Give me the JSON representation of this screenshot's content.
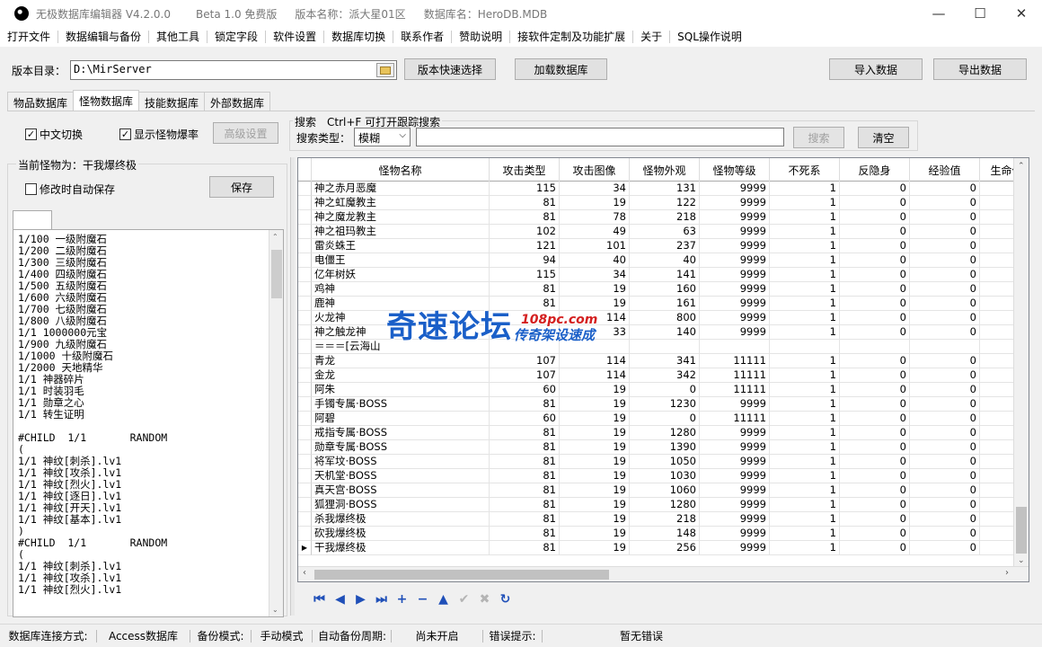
{
  "window": {
    "title_segments": [
      "无极数据库编辑器 V4.2.0.0",
      "Beta 1.0 免费版",
      "版本名称：派大星01区",
      "数据库名：HeroDB.MDB"
    ],
    "minimize": "—",
    "maximize": "☐",
    "close": "✕"
  },
  "menu": [
    "打开文件",
    "数据编辑与备份",
    "其他工具",
    "锁定字段",
    "软件设置",
    "数据库切换",
    "联系作者",
    "赞助说明",
    "接软件定制及功能扩展",
    "关于",
    "SQL操作说明"
  ],
  "toolbar": {
    "dir_label": "版本目录：",
    "dir_value": "D:\\MirServer",
    "version_quick_select": "版本快速选择",
    "load_db": "加载数据库",
    "import_data": "导入数据",
    "export_data": "导出数据"
  },
  "tabs": [
    "物品数据库",
    "怪物数据库",
    "技能数据库",
    "外部数据库"
  ],
  "active_tab": 1,
  "options": {
    "chinese_switch": "中文切换",
    "chinese_switch_checked": true,
    "show_drop_rate": "显示怪物爆率",
    "show_drop_rate_checked": true,
    "advanced": "高级设置"
  },
  "search": {
    "group_title": "搜索　Ctrl+F 可打开跟踪搜索",
    "type_label": "搜索类型：",
    "type_value": "模糊",
    "query": "",
    "search_btn": "搜索",
    "clear_btn": "清空"
  },
  "left": {
    "current_monster": "当前怪物为：干我爆终极",
    "autosave": "修改时自动保存",
    "autosave_checked": false,
    "save_btn": "保存",
    "drop_lines": [
      "1/100 一级附魔石",
      "1/200 二级附魔石",
      "1/300 三级附魔石",
      "1/400 四级附魔石",
      "1/500 五级附魔石",
      "1/600 六级附魔石",
      "1/700 七级附魔石",
      "1/800 八级附魔石",
      "1/1 1000000元宝",
      "1/900 九级附魔石",
      "1/1000 十级附魔石",
      "1/2000 天地精华",
      "1/1 神器碎片",
      "1/1 时装羽毛",
      "1/1 勋章之心",
      "1/1 转生证明",
      "",
      "#CHILD  1/1       RANDOM",
      "(",
      "1/1 神纹[刺杀].lv1",
      "1/1 神纹[攻杀].lv1",
      "1/1 神纹[烈火].lv1",
      "1/1 神纹[逐日].lv1",
      "1/1 神纹[开天].lv1",
      "1/1 神纹[基本].lv1",
      ")",
      "#CHILD  1/1       RANDOM",
      "(",
      "1/1 神纹[刺杀].lv1",
      "1/1 神纹[攻杀].lv1",
      "1/1 神纹[烈火].lv1"
    ]
  },
  "grid": {
    "columns": [
      "怪物名称",
      "攻击类型",
      "攻击图像",
      "怪物外观",
      "怪物等级",
      "不死系",
      "反隐身",
      "经验值",
      "生命值"
    ],
    "rows": [
      [
        "神之赤月恶魔",
        "115",
        "34",
        "131",
        "9999",
        "1",
        "0",
        "0",
        ""
      ],
      [
        "神之虹魔教主",
        "81",
        "19",
        "122",
        "9999",
        "1",
        "0",
        "0",
        ""
      ],
      [
        "神之魔龙教主",
        "81",
        "78",
        "218",
        "9999",
        "1",
        "0",
        "0",
        ""
      ],
      [
        "神之祖玛教主",
        "102",
        "49",
        "63",
        "9999",
        "1",
        "0",
        "0",
        ""
      ],
      [
        "雷炎蛛王",
        "121",
        "101",
        "237",
        "9999",
        "1",
        "0",
        "0",
        ""
      ],
      [
        "电僵王",
        "94",
        "40",
        "40",
        "9999",
        "1",
        "0",
        "0",
        ""
      ],
      [
        "亿年树妖",
        "115",
        "34",
        "141",
        "9999",
        "1",
        "0",
        "0",
        ""
      ],
      [
        "鸡神",
        "81",
        "19",
        "160",
        "9999",
        "1",
        "0",
        "0",
        ""
      ],
      [
        "鹿神",
        "81",
        "19",
        "161",
        "9999",
        "1",
        "0",
        "0",
        ""
      ],
      [
        "火龙神",
        "",
        "114",
        "800",
        "9999",
        "1",
        "0",
        "0",
        ""
      ],
      [
        "神之触龙神",
        "",
        "33",
        "140",
        "9999",
        "1",
        "0",
        "0",
        ""
      ],
      [
        "＝＝＝[云海山",
        "",
        "",
        "",
        "",
        "",
        "",
        "",
        ""
      ],
      [
        "青龙",
        "107",
        "114",
        "341",
        "11111",
        "1",
        "0",
        "0",
        ""
      ],
      [
        "金龙",
        "107",
        "114",
        "342",
        "11111",
        "1",
        "0",
        "0",
        ""
      ],
      [
        "阿朱",
        "60",
        "19",
        "0",
        "11111",
        "1",
        "0",
        "0",
        ""
      ],
      [
        "手镯专属·BOSS",
        "81",
        "19",
        "1230",
        "9999",
        "1",
        "0",
        "0",
        ""
      ],
      [
        "阿碧",
        "60",
        "19",
        "0",
        "11111",
        "1",
        "0",
        "0",
        ""
      ],
      [
        "戒指专属·BOSS",
        "81",
        "19",
        "1280",
        "9999",
        "1",
        "0",
        "0",
        ""
      ],
      [
        "勋章专属·BOSS",
        "81",
        "19",
        "1390",
        "9999",
        "1",
        "0",
        "0",
        ""
      ],
      [
        "将军坟·BOSS",
        "81",
        "19",
        "1050",
        "9999",
        "1",
        "0",
        "0",
        ""
      ],
      [
        "天机堂·BOSS",
        "81",
        "19",
        "1030",
        "9999",
        "1",
        "0",
        "0",
        ""
      ],
      [
        "真天宫·BOSS",
        "81",
        "19",
        "1060",
        "9999",
        "1",
        "0",
        "0",
        ""
      ],
      [
        "狐狸洞·BOSS",
        "81",
        "19",
        "1280",
        "9999",
        "1",
        "0",
        "0",
        ""
      ],
      [
        "杀我爆终极",
        "81",
        "19",
        "218",
        "9999",
        "1",
        "0",
        "0",
        ""
      ],
      [
        "砍我爆终极",
        "81",
        "19",
        "148",
        "9999",
        "1",
        "0",
        "0",
        ""
      ],
      [
        "干我爆终极",
        "81",
        "19",
        "256",
        "9999",
        "1",
        "0",
        "0",
        ""
      ]
    ],
    "current_row": 25,
    "current_marker": "▶"
  },
  "nav": [
    {
      "name": "first-record-icon",
      "glyph": "⏮",
      "enabled": true
    },
    {
      "name": "prior-record-icon",
      "glyph": "◀",
      "enabled": true
    },
    {
      "name": "next-record-icon",
      "glyph": "▶",
      "enabled": true
    },
    {
      "name": "last-record-icon",
      "glyph": "⏭",
      "enabled": true
    },
    {
      "name": "insert-record-icon",
      "glyph": "+",
      "enabled": true
    },
    {
      "name": "delete-record-icon",
      "glyph": "−",
      "enabled": true
    },
    {
      "name": "edit-record-icon",
      "glyph": "▲",
      "enabled": true
    },
    {
      "name": "post-record-icon",
      "glyph": "✔",
      "enabled": false
    },
    {
      "name": "cancel-record-icon",
      "glyph": "✖",
      "enabled": false
    },
    {
      "name": "refresh-record-icon",
      "glyph": "↻",
      "enabled": true
    }
  ],
  "status": {
    "conn_label": "数据库连接方式:",
    "conn_value": "Access数据库",
    "backup_mode_label": "备份模式:",
    "backup_mode_value": "手动模式",
    "auto_backup_label": "自动备份周期:",
    "auto_backup_value": "尚未开启",
    "error_label": "错误提示:",
    "error_value": "暂无错误"
  },
  "watermark": {
    "main": "奇速论坛",
    "url": "108pc.com",
    "sub": "传奇架设速成"
  },
  "colors": {
    "nav_blue": "#1f4fb8",
    "watermark_blue": "#1a5fc8",
    "watermark_red": "#d42020"
  }
}
